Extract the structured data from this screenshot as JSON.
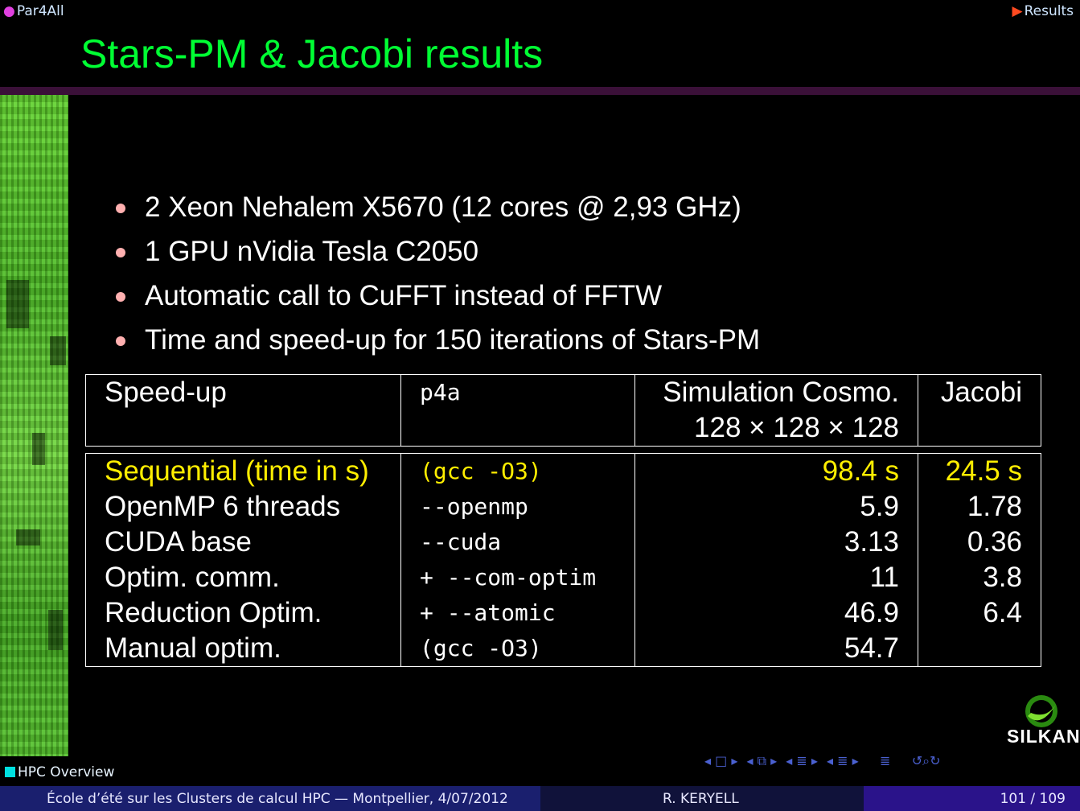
{
  "header": {
    "left": "Par4All",
    "right": "Results"
  },
  "slide": {
    "title": "Stars-PM & Jacobi results",
    "bullets": [
      "2 Xeon Nehalem X5670 (12 cores @ 2,93 GHz)",
      "1 GPU nVidia Tesla C2050",
      "Automatic call to CuFFT instead of FFTW",
      "Time and speed-up for 150 iterations of Stars-PM"
    ]
  },
  "table": {
    "headers": [
      "Speed-up",
      "p4a",
      "Simulation Cosmo.",
      "Jacobi"
    ],
    "header_subline": "128 × 128 × 128",
    "rows": [
      [
        "Sequential (time in s)",
        "(gcc -O3)",
        "98.4 s",
        "24.5 s"
      ],
      [
        "OpenMP 6 threads",
        "--openmp",
        "5.9",
        "1.78"
      ],
      [
        "CUDA base",
        "--cuda",
        "3.13",
        "0.36"
      ],
      [
        "Optim. comm.",
        "+ --com-optim",
        "11",
        "3.8"
      ],
      [
        "Reduction Optim.",
        "+ --atomic",
        "46.9",
        "6.4"
      ],
      [
        "Manual optim.",
        "(gcc -O3)",
        "54.7",
        ""
      ]
    ]
  },
  "logo": {
    "text": "SILKAN"
  },
  "section_label": "HPC Overview",
  "footer": {
    "event": "École d’été sur les Clusters de calcul HPC — Montpellier, 4/07/2012",
    "author": "R. KERYELL",
    "page": "101 / 109"
  },
  "colors": {
    "title": "#00ff33",
    "highlight": "#ffee00",
    "footer_left": "#1a1f6e",
    "footer_right": "#2a138a"
  }
}
